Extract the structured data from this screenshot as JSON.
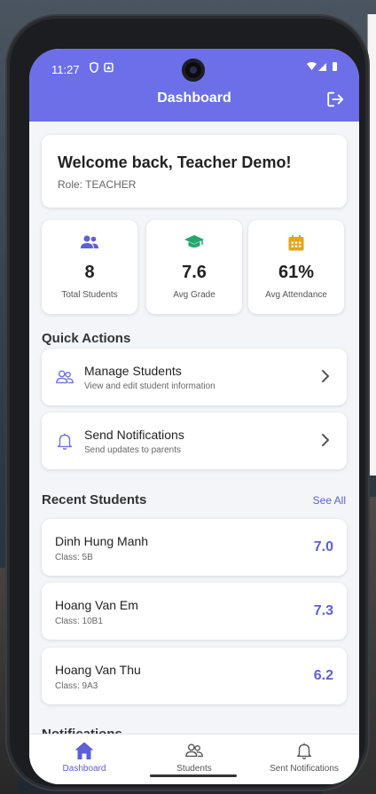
{
  "status_bar": {
    "time": "11:27"
  },
  "header": {
    "title": "Dashboard"
  },
  "welcome": {
    "title": "Welcome back, Teacher Demo!",
    "role": "Role: TEACHER"
  },
  "stats": [
    {
      "value": "8",
      "label": "Total Students",
      "icon": "people-icon",
      "color": "#5d60d8"
    },
    {
      "value": "7.6",
      "label": "Avg Grade",
      "icon": "graduation-cap-icon",
      "color": "#22a86b"
    },
    {
      "value": "61%",
      "label": "Avg Attendance",
      "icon": "calendar-icon",
      "color": "#e8a317"
    }
  ],
  "quick_actions": {
    "title": "Quick Actions",
    "items": [
      {
        "title": "Manage Students",
        "subtitle": "View and edit student information",
        "icon": "people-outline-icon"
      },
      {
        "title": "Send Notifications",
        "subtitle": "Send updates to parents",
        "icon": "bell-outline-icon"
      }
    ]
  },
  "recent_students": {
    "title": "Recent Students",
    "see_all": "See All",
    "items": [
      {
        "name": "Dinh Hung Manh",
        "class": "Class: 5B",
        "grade": "7.0"
      },
      {
        "name": "Hoang Van Em",
        "class": "Class: 10B1",
        "grade": "7.3"
      },
      {
        "name": "Hoang Van Thu",
        "class": "Class: 9A3",
        "grade": "6.2"
      }
    ]
  },
  "notifications": {
    "title": "Notifications"
  },
  "bottom_nav": {
    "items": [
      {
        "label": "Dashboard",
        "icon": "home-icon",
        "active": true
      },
      {
        "label": "Students",
        "icon": "people-outline-icon",
        "active": false
      },
      {
        "label": "Sent Notifications",
        "icon": "bell-outline-icon",
        "active": false
      }
    ]
  },
  "colors": {
    "accent": "#6c6fe8",
    "link": "#5d60d8"
  }
}
